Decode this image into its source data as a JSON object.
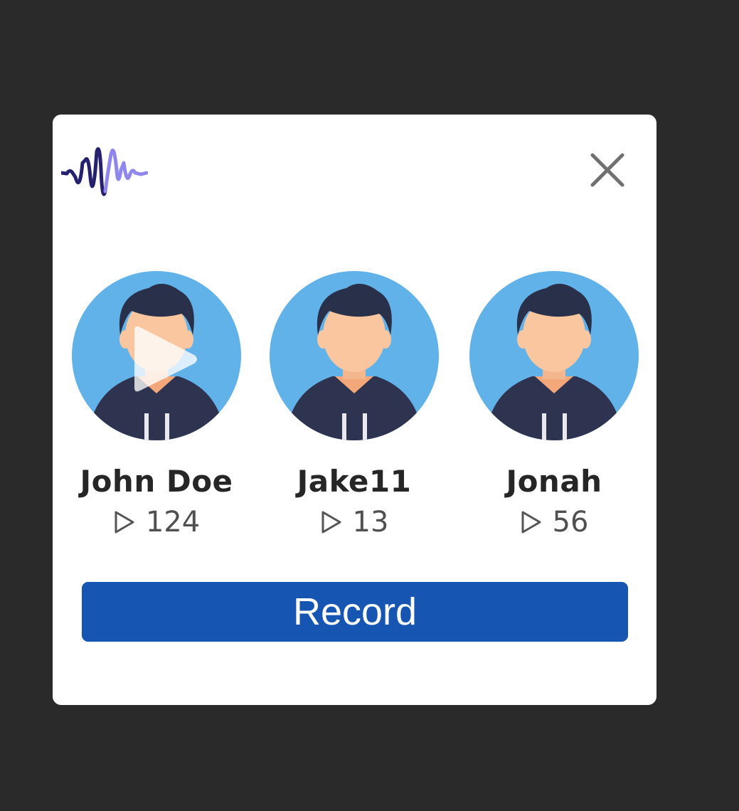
{
  "dialog": {
    "logo_icon": "sound-wave-icon",
    "close_icon": "close-icon"
  },
  "profiles": [
    {
      "name": "John Doe",
      "plays": "124",
      "now_playing": true
    },
    {
      "name": "Jake11",
      "plays": "13",
      "now_playing": false
    },
    {
      "name": "Jonah",
      "plays": "56",
      "now_playing": false
    }
  ],
  "record_button": {
    "label": "Record"
  },
  "colors": {
    "backdrop": "#2b2a2a",
    "card": "#ffffff",
    "accent": "#1655b2",
    "avatar_bg": "#62b2ea",
    "logo_dark": "#25216e",
    "logo_light": "#8f86ee"
  }
}
